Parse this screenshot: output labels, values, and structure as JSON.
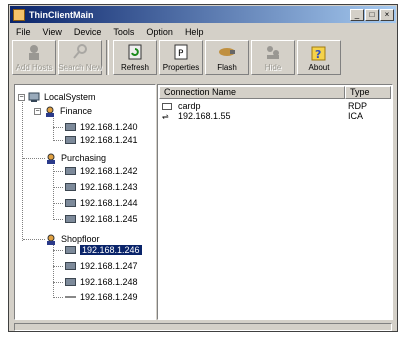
{
  "window": {
    "title": "ThinClientMain"
  },
  "menu": [
    "File",
    "View",
    "Device",
    "Tools",
    "Option",
    "Help"
  ],
  "toolbar": [
    {
      "label": "Add Hosts",
      "icon": "add-hosts-icon",
      "enabled": false
    },
    {
      "label": "Search New",
      "icon": "search-icon",
      "enabled": false
    },
    {
      "label": "Refresh",
      "icon": "refresh-icon",
      "enabled": true
    },
    {
      "label": "Properties",
      "icon": "properties-icon",
      "enabled": true
    },
    {
      "label": "Flash",
      "icon": "flash-icon",
      "enabled": true
    },
    {
      "label": "Hide",
      "icon": "hide-icon",
      "enabled": false
    },
    {
      "label": "About",
      "icon": "about-icon",
      "enabled": true
    }
  ],
  "tree": {
    "root": "LocalSystem",
    "groups": [
      {
        "name": "Finance",
        "hosts": [
          "192.168.1.240",
          "192.168.1.241"
        ]
      },
      {
        "name": "Purchasing",
        "hosts": [
          "192.168.1.242",
          "192.168.1.243",
          "192.168.1.244",
          "192.168.1.245"
        ]
      },
      {
        "name": "Shopfloor",
        "hosts": [
          "192.168.1.246",
          "192.168.1.247",
          "192.168.1.248",
          "192.168.1.249"
        ]
      }
    ],
    "selected": "192.168.1.246"
  },
  "list": {
    "columns": [
      "Connection Name",
      "Type"
    ],
    "rows": [
      {
        "name": "cardp",
        "type": "RDP"
      },
      {
        "name": "192.168.1.55",
        "type": "ICA"
      }
    ]
  }
}
